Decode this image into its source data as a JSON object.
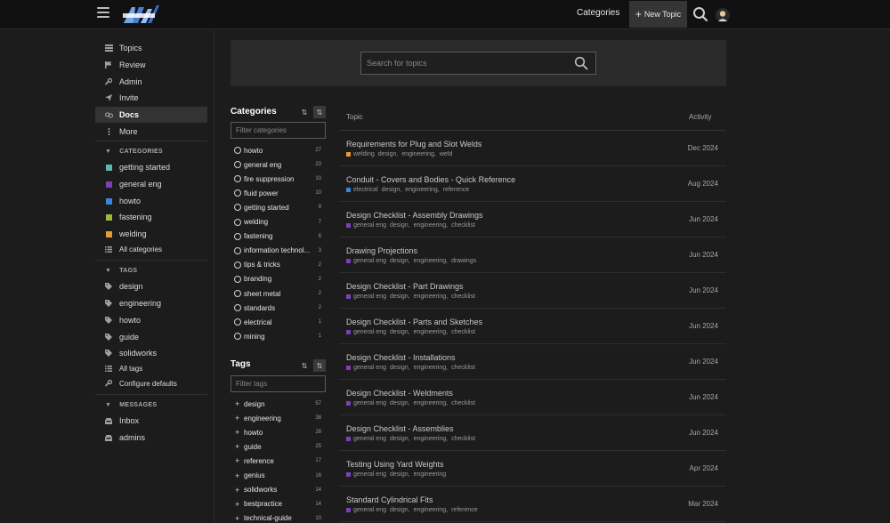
{
  "header": {
    "nav_categories": "Categories",
    "new_topic": "New Topic",
    "colors": {
      "bg": "#111111",
      "accent": "#353535"
    }
  },
  "sidebar": {
    "main_items": [
      {
        "label": "Topics",
        "icon": "topics-icon"
      },
      {
        "label": "Review",
        "icon": "flag-icon"
      },
      {
        "label": "Admin",
        "icon": "wrench-icon"
      },
      {
        "label": "Invite",
        "icon": "send-icon"
      },
      {
        "label": "Docs",
        "icon": "link-icon",
        "active": true
      },
      {
        "label": "More",
        "icon": "more-vertical-icon"
      }
    ],
    "categories_header": "CATEGORIES",
    "categories": [
      {
        "label": "getting started",
        "color": "#5fb4b4"
      },
      {
        "label": "general eng",
        "color": "#7e3fb8"
      },
      {
        "label": "howto",
        "color": "#3a86d8"
      },
      {
        "label": "fastening",
        "color": "#9ab83a"
      },
      {
        "label": "welding",
        "color": "#e39d32"
      }
    ],
    "all_categories": "All categories",
    "tags_header": "TAGS",
    "tags": [
      "design",
      "engineering",
      "howto",
      "guide",
      "solidworks"
    ],
    "all_tags": "All tags",
    "configure_defaults": "Configure defaults",
    "messages_header": "MESSAGES",
    "messages": [
      "Inbox",
      "admins"
    ]
  },
  "search": {
    "placeholder": "Search for topics"
  },
  "categories_panel": {
    "title": "Categories",
    "filter_placeholder": "Filter categories",
    "items": [
      {
        "name": "howto",
        "count": "27"
      },
      {
        "name": "general eng",
        "count": "23"
      },
      {
        "name": "fire suppression",
        "count": "10"
      },
      {
        "name": "fluid power",
        "count": "10"
      },
      {
        "name": "getting started",
        "count": "9"
      },
      {
        "name": "welding",
        "count": "7"
      },
      {
        "name": "fastening",
        "count": "6"
      },
      {
        "name": "information technol...",
        "count": "3"
      },
      {
        "name": "tips & tricks",
        "count": "2"
      },
      {
        "name": "branding",
        "count": "2"
      },
      {
        "name": "sheet metal",
        "count": "2"
      },
      {
        "name": "standards",
        "count": "2"
      },
      {
        "name": "electrical",
        "count": "1"
      },
      {
        "name": "mining",
        "count": "1"
      }
    ]
  },
  "tags_panel": {
    "title": "Tags",
    "filter_placeholder": "Filter tags",
    "items": [
      {
        "name": "design",
        "count": "57"
      },
      {
        "name": "engineering",
        "count": "38"
      },
      {
        "name": "howto",
        "count": "28"
      },
      {
        "name": "guide",
        "count": "25"
      },
      {
        "name": "reference",
        "count": "17"
      },
      {
        "name": "genius",
        "count": "16"
      },
      {
        "name": "solidworks",
        "count": "14"
      },
      {
        "name": "bestpractice",
        "count": "14"
      },
      {
        "name": "technical-guide",
        "count": "10"
      }
    ]
  },
  "topics": {
    "col_topic": "Topic",
    "col_activity": "Activity",
    "rows": [
      {
        "title": "Requirements for Plug and Slot Welds",
        "category": "welding",
        "cat_color": "#e39d32",
        "tags": [
          "design,",
          "engineering,",
          "weld"
        ],
        "date": "Dec 2024"
      },
      {
        "title": "Conduit - Covers and Bodies - Quick Reference",
        "category": "electrical",
        "cat_color": "#3a86d8",
        "tags": [
          "design,",
          "engineering,",
          "reference"
        ],
        "date": "Aug 2024"
      },
      {
        "title": "Design Checklist - Assembly Drawings",
        "category": "general eng",
        "cat_color": "#7e3fb8",
        "tags": [
          "design,",
          "engineering,",
          "checklist"
        ],
        "date": "Jun 2024"
      },
      {
        "title": "Drawing Projections",
        "category": "general eng",
        "cat_color": "#7e3fb8",
        "tags": [
          "design,",
          "engineering,",
          "drawings"
        ],
        "date": "Jun 2024"
      },
      {
        "title": "Design Checklist - Part Drawings",
        "category": "general eng",
        "cat_color": "#7e3fb8",
        "tags": [
          "design,",
          "engineering,",
          "checklist"
        ],
        "date": "Jun 2024"
      },
      {
        "title": "Design Checklist - Parts and Sketches",
        "category": "general eng",
        "cat_color": "#7e3fb8",
        "tags": [
          "design,",
          "engineering,",
          "checklist"
        ],
        "date": "Jun 2024"
      },
      {
        "title": "Design Checklist - Installations",
        "category": "general eng",
        "cat_color": "#7e3fb8",
        "tags": [
          "design,",
          "engineering,",
          "checklist"
        ],
        "date": "Jun 2024"
      },
      {
        "title": "Design Checklist - Weldments",
        "category": "general eng",
        "cat_color": "#7e3fb8",
        "tags": [
          "design,",
          "engineering,",
          "checklist"
        ],
        "date": "Jun 2024"
      },
      {
        "title": "Design Checklist - Assemblies",
        "category": "general eng",
        "cat_color": "#7e3fb8",
        "tags": [
          "design,",
          "engineering,",
          "checklist"
        ],
        "date": "Jun 2024"
      },
      {
        "title": "Testing Using Yard Weights",
        "category": "general eng",
        "cat_color": "#7e3fb8",
        "tags": [
          "design,",
          "engineering"
        ],
        "date": "Apr 2024"
      },
      {
        "title": "Standard Cylindrical Fits",
        "category": "general eng",
        "cat_color": "#7e3fb8",
        "tags": [
          "design,",
          "engineering,",
          "reference"
        ],
        "date": "Mar 2024"
      }
    ]
  }
}
